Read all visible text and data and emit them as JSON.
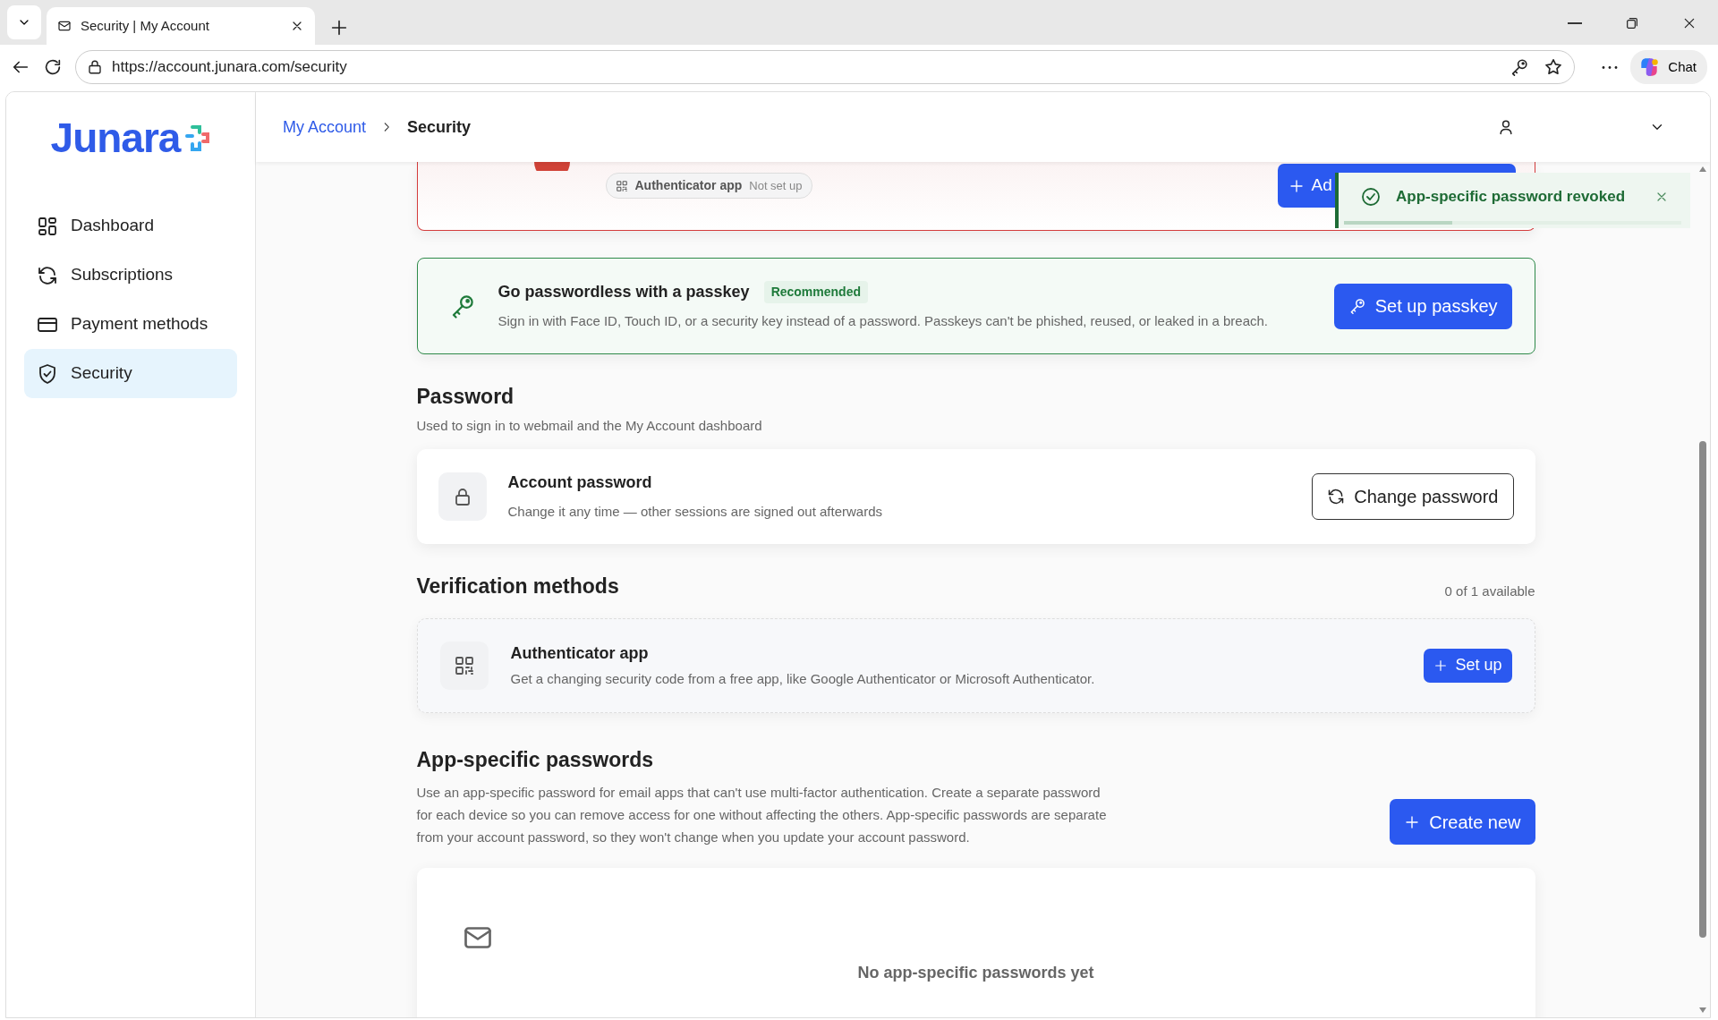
{
  "browser": {
    "tab_title": "Security | My Account",
    "url": "https://account.junara.com/security",
    "chat_label": "Chat"
  },
  "sidebar": {
    "logo": "Junara",
    "items": [
      {
        "label": "Dashboard",
        "kind": "grid",
        "selected": false
      },
      {
        "label": "Subscriptions",
        "kind": "refresh",
        "selected": false
      },
      {
        "label": "Payment methods",
        "kind": "card",
        "selected": false
      },
      {
        "label": "Security",
        "kind": "shield",
        "selected": true
      }
    ]
  },
  "breadcrumb": [
    {
      "label": "My Account",
      "kind": "link"
    },
    {
      "label": "Security",
      "kind": "current"
    }
  ],
  "alert_card": {
    "chip": {
      "label": "Authenticator app",
      "status": "Not set up"
    },
    "button": "Ad"
  },
  "toast": {
    "message": "App-specific password revoked",
    "level": 0.32
  },
  "passkey": {
    "title": "Go passwordless with a passkey",
    "badge": "Recommended",
    "description": "Sign in with Face ID, Touch ID, or a security key instead of a password. Passkeys can't be phished, reused, or leaked in a breach.",
    "button": "Set up passkey"
  },
  "password": {
    "title": "Password",
    "subtitle": "Used to sign in to webmail and the My Account dashboard",
    "card": {
      "title": "Account password",
      "description": "Change it any time — other sessions are signed out afterwards",
      "button": "Change password"
    }
  },
  "verification": {
    "title": "Verification methods",
    "count": "0 of 1 available",
    "methods": [
      {
        "title": "Authenticator app",
        "description": "Get a changing security code from a free app, like Google Authenticator or Microsoft Authenticator.",
        "button": "Set up"
      }
    ]
  },
  "app_passwords": {
    "title": "App-specific passwords",
    "description": "Use an app-specific password for email apps that can't use multi-factor authentication. Create a separate password for each device so you can remove access for one without affecting the others. App-specific passwords are separate from your account password, so they won't change when you update your account password.",
    "button": "Create new",
    "empty_text": "No app-specific passwords yet"
  }
}
